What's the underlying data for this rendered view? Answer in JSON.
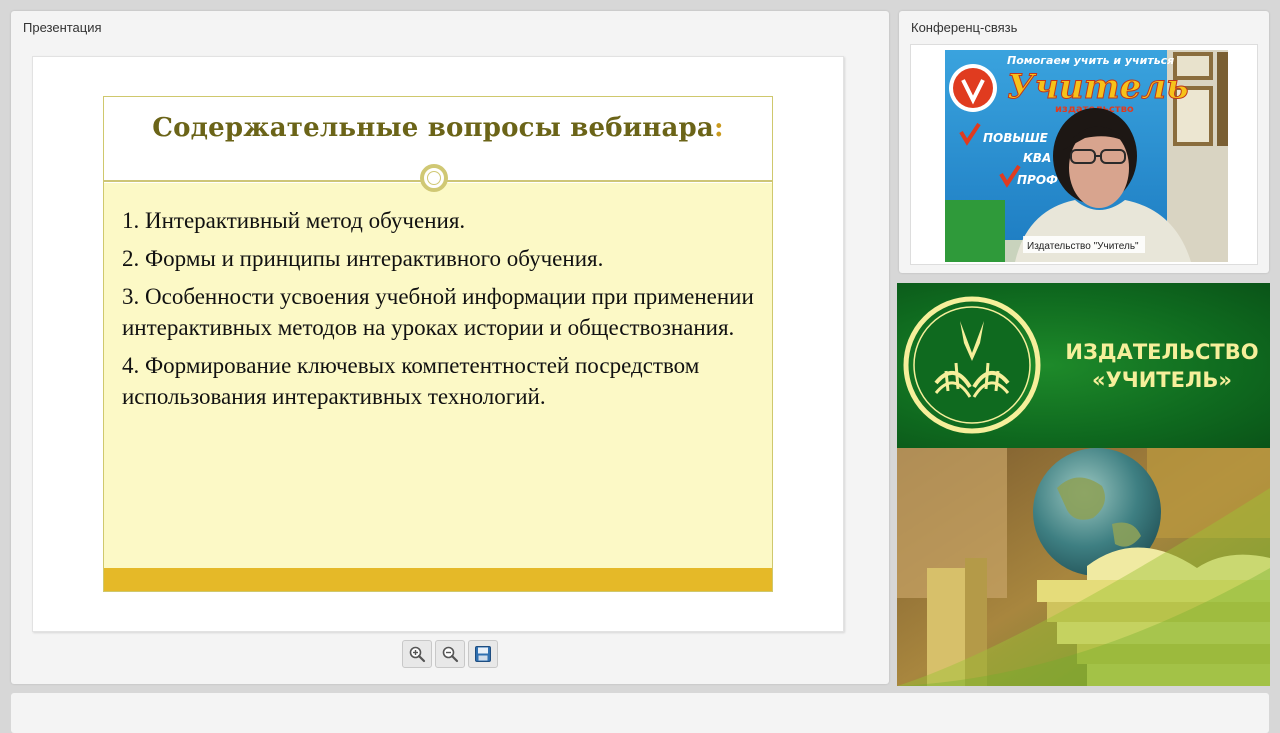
{
  "presentation": {
    "title": "Презентация",
    "slide": {
      "title": "Содержательные вопросы вебинара",
      "title_colon": ":",
      "items": [
        "1. Интерактивный метод обучения.",
        "2. Формы и принципы интерактивного обучения.",
        "3. Особенности усвоения учебной информации при применении интерактивных методов на уроках истории и обществознания.",
        "4. Формирование ключевых компетентностей посредством использования интерактивных технологий."
      ]
    },
    "toolbar": {
      "zoom_in_icon": "zoom-in-icon",
      "zoom_out_icon": "zoom-out-icon",
      "save_icon": "floppy-disk-icon"
    }
  },
  "conference": {
    "title": "Конференц-связь",
    "speaker_label": "Издательство \"Учитель\"",
    "banner": {
      "line1": "Помогаем учить и учиться",
      "brand": "Учитель",
      "sub": "издательство",
      "check1": "ПОВЫШЕ",
      "check2": "КВА",
      "check3": "ПРОФ"
    }
  },
  "publisher_ad": {
    "line1": "ИЗДАТЕЛЬСТВО",
    "line2": "«УЧИТЕЛЬ»"
  },
  "colors": {
    "slide_title": "#6b6418",
    "slide_bg": "#fcf9c6",
    "slide_footer": "#e5b928",
    "ad_green": "#0f6a1f",
    "ad_text": "#f6ef9b"
  }
}
